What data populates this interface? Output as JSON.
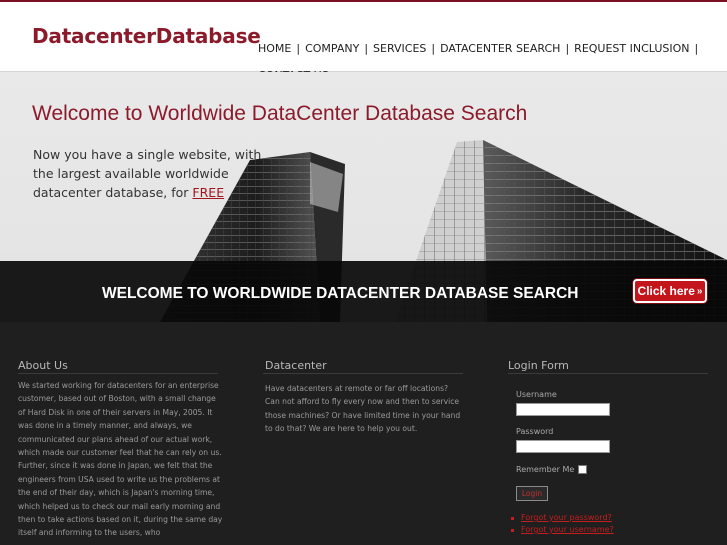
{
  "header": {
    "logo": "DatacenterDatabase",
    "nav": [
      {
        "label": "HOME"
      },
      {
        "label": "COMPANY"
      },
      {
        "label": "SERVICES"
      },
      {
        "label": "DATACENTER SEARCH"
      },
      {
        "label": "REQUEST INCLUSION"
      },
      {
        "label": "CONTACT US"
      }
    ],
    "separator": "|"
  },
  "hero": {
    "title": "Welcome to Worldwide DataCenter Database Search",
    "copy": "Now you have a single website, with the largest available worldwide datacenter database, for",
    "free_link": "FREE",
    "banner_text": "WELCOME TO WORLDWIDE DATACENTER DATABASE SEARCH",
    "cta_button": "Click here"
  },
  "footer": {
    "about": {
      "title": "About Us",
      "text": "We started working for datacenters for an enterprise customer, based out of Boston, with a small change of Hard Disk in one of their servers in May, 2005. It was done in a timely manner, and always, we communicated our plans ahead of our actual work, which made our customer feel that he can rely on us. Further, since it was done in Japan, we felt that the engineers from USA used to write us the problems at the end of their day, which is Japan's morning time, which helped us to check our mail early morning and then to take actions based on it, during the same day itself and informing to the users, who"
    },
    "datacenter": {
      "title": "Datacenter",
      "text": "Have datacenters at remote or far off locations? Can not afford to fly every now and then to service those machines? Or have limited time in your hand to do that? We are here to help you out."
    },
    "login": {
      "title": "Login Form",
      "username_label": "Username",
      "username_value": "",
      "password_label": "Password",
      "password_value": "",
      "remember_label": "Remember Me",
      "login_button": "Login",
      "forgot_password": "Forgot your password?",
      "forgot_username": "Forgot your username?"
    }
  },
  "colors": {
    "brand": "#8b1a2b",
    "cta": "#c4141c",
    "footer_bg": "#1f1f1f",
    "link": "#c41e1e"
  }
}
